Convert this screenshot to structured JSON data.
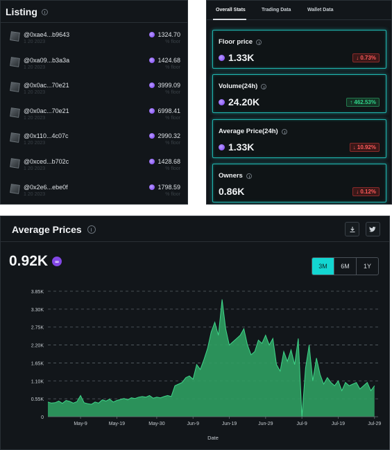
{
  "listing": {
    "title": "Listing",
    "rows": [
      {
        "address": "@0xae4...b9643",
        "time": "1 20 2023",
        "price": "1324.70",
        "sub": "% floor"
      },
      {
        "address": "@0xa09...b3a3a",
        "time": "1 20 2023",
        "price": "1424.68",
        "sub": "% floor"
      },
      {
        "address": "@0x0ac...70e21",
        "time": "1 20 2023",
        "price": "3999.09",
        "sub": "% floor"
      },
      {
        "address": "@0x0ac...70e21",
        "time": "1 20 2023",
        "price": "6998.41",
        "sub": "% floor"
      },
      {
        "address": "@0x110...4c07c",
        "time": "1 20 2023",
        "price": "2990.32",
        "sub": "% floor"
      },
      {
        "address": "@0xced...b702c",
        "time": "1 20 2023",
        "price": "1428.68",
        "sub": "% floor"
      },
      {
        "address": "@0x2e6...ebe0f",
        "time": "1 20 2023",
        "price": "1798.59",
        "sub": "% floor"
      }
    ]
  },
  "stats": {
    "tabs": [
      "Overall Stats",
      "Trading Data",
      "Wallet Data"
    ],
    "active_tab": 0,
    "cards": [
      {
        "label": "Floor price",
        "value": "1.33K",
        "change": "↓ 0.73%",
        "direction": "down",
        "token": true
      },
      {
        "label": "Volume(24h)",
        "value": "24.20K",
        "change": "↑ 462.53%",
        "direction": "up",
        "token": true
      },
      {
        "label": "Average Price(24h)",
        "value": "1.33K",
        "change": "↓ 10.92%",
        "direction": "down",
        "token": true
      },
      {
        "label": "Owners",
        "value": "0.86K",
        "change": "↓ 0.12%",
        "direction": "down",
        "token": false
      }
    ]
  },
  "average_prices": {
    "title": "Average Prices",
    "value": "0.92K",
    "ranges": [
      "3M",
      "6M",
      "1Y"
    ],
    "active_range": 0,
    "icons": {
      "download": "download-icon",
      "twitter": "twitter-icon",
      "link": "link-icon"
    }
  },
  "colors": {
    "accent": "#13d6d1",
    "fill": "#2f9e62",
    "line": "#3fd68a",
    "down": "#ff5a5a",
    "up": "#2fd38a"
  },
  "chart_data": {
    "type": "area",
    "title": "",
    "xlabel": "Date",
    "ylabel": "",
    "ylim": [
      0,
      3850
    ],
    "y_ticks": [
      "0",
      "0.55K",
      "1.10K",
      "1.65K",
      "2.20K",
      "2.75K",
      "3.30K",
      "3.85K"
    ],
    "y_tick_values": [
      0,
      550,
      1100,
      1650,
      2200,
      2750,
      3300,
      3850
    ],
    "x_ticks": [
      "May-9",
      "May-19",
      "May-30",
      "Jun-9",
      "Jun-19",
      "Jun-29",
      "Jul-9",
      "Jul-19",
      "Jul-29"
    ],
    "x_tick_days": [
      9,
      19,
      30,
      40,
      50,
      60,
      70,
      80,
      90
    ],
    "xlim": [
      0,
      91
    ],
    "grid": true,
    "series": [
      {
        "x": [
          0,
          1,
          2,
          3,
          4,
          5,
          6,
          7,
          8,
          9,
          10,
          11,
          12,
          13,
          14,
          15,
          16,
          17,
          18,
          19,
          20,
          21,
          22,
          23,
          24,
          25,
          26,
          27,
          28,
          29,
          30,
          31,
          32,
          33,
          34,
          35,
          36,
          37,
          38,
          39,
          40,
          41,
          42,
          43,
          44,
          45,
          46,
          47,
          48,
          49,
          50,
          51,
          52,
          53,
          54,
          55,
          56,
          57,
          58,
          59,
          60,
          61,
          62,
          63,
          64,
          65,
          66,
          67,
          68,
          69,
          70,
          71,
          72,
          73,
          74,
          75,
          76,
          77,
          78,
          79,
          80,
          81,
          82,
          83,
          84,
          85,
          86,
          87,
          88,
          89,
          90
        ],
        "y": [
          450,
          420,
          430,
          480,
          410,
          500,
          470,
          420,
          460,
          650,
          430,
          400,
          380,
          450,
          420,
          520,
          480,
          540,
          450,
          500,
          530,
          560,
          520,
          580,
          560,
          600,
          620,
          600,
          650,
          570,
          600,
          580,
          620,
          650,
          620,
          950,
          1000,
          1050,
          1200,
          1250,
          1150,
          1600,
          1450,
          1750,
          2100,
          2600,
          2900,
          2500,
          3600,
          2700,
          2200,
          2300,
          2400,
          2500,
          2700,
          2200,
          1900,
          2000,
          2350,
          2250,
          2500,
          2200,
          2400,
          1600,
          1400,
          2000,
          1700,
          2050,
          1600,
          2400,
          0,
          1500,
          2200,
          1100,
          1800,
          1300,
          1000,
          1200,
          1050,
          950,
          1100,
          800,
          1050,
          950,
          1000,
          1050,
          850,
          950,
          1050,
          800,
          950
        ]
      }
    ]
  }
}
